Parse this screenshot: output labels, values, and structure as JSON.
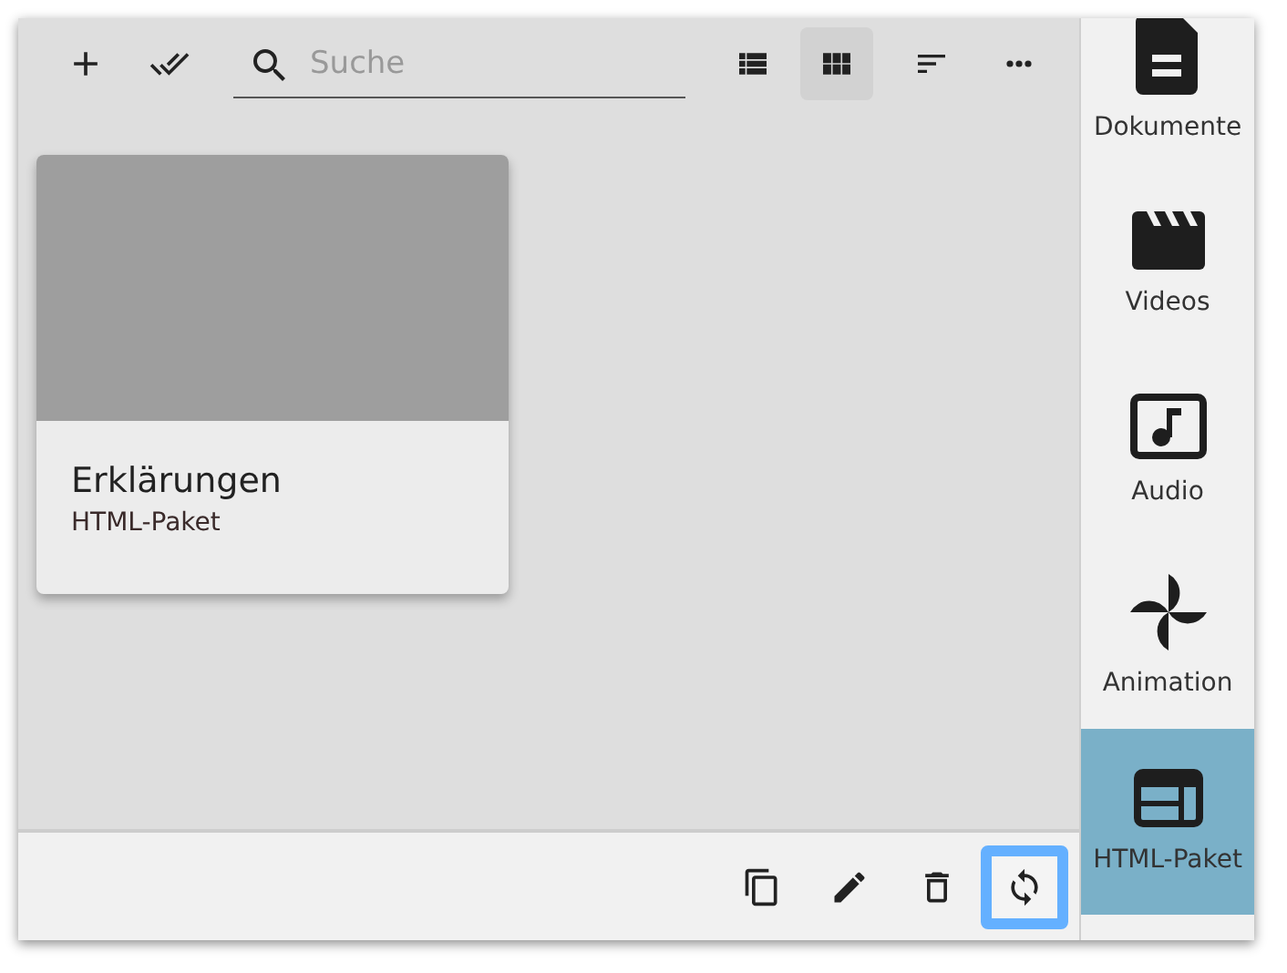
{
  "toolbar": {
    "actions": [
      {
        "kind": "add"
      },
      {
        "kind": "select-all"
      }
    ],
    "search": {
      "placeholder": "Suche"
    },
    "views": [
      {
        "kind": "list",
        "selected": false
      },
      {
        "kind": "grid",
        "selected": true
      }
    ],
    "tools": [
      {
        "kind": "sort"
      },
      {
        "kind": "more"
      }
    ]
  },
  "cards": [
    {
      "title": "Erklärungen",
      "subtitle": "HTML-Paket"
    }
  ],
  "bottom_actions": [
    {
      "kind": "copy",
      "focused": false
    },
    {
      "kind": "edit",
      "focused": false
    },
    {
      "kind": "delete",
      "focused": false
    },
    {
      "kind": "sync",
      "focused": true
    }
  ],
  "sidebar": {
    "items": [
      {
        "kind": "document",
        "label": "Dokumente",
        "selected": false
      },
      {
        "kind": "video",
        "label": "Videos",
        "selected": false
      },
      {
        "kind": "audio",
        "label": "Audio",
        "selected": false
      },
      {
        "kind": "animation",
        "label": "Animation",
        "selected": false
      },
      {
        "kind": "html",
        "label": "HTML-Paket",
        "selected": true
      }
    ]
  }
}
